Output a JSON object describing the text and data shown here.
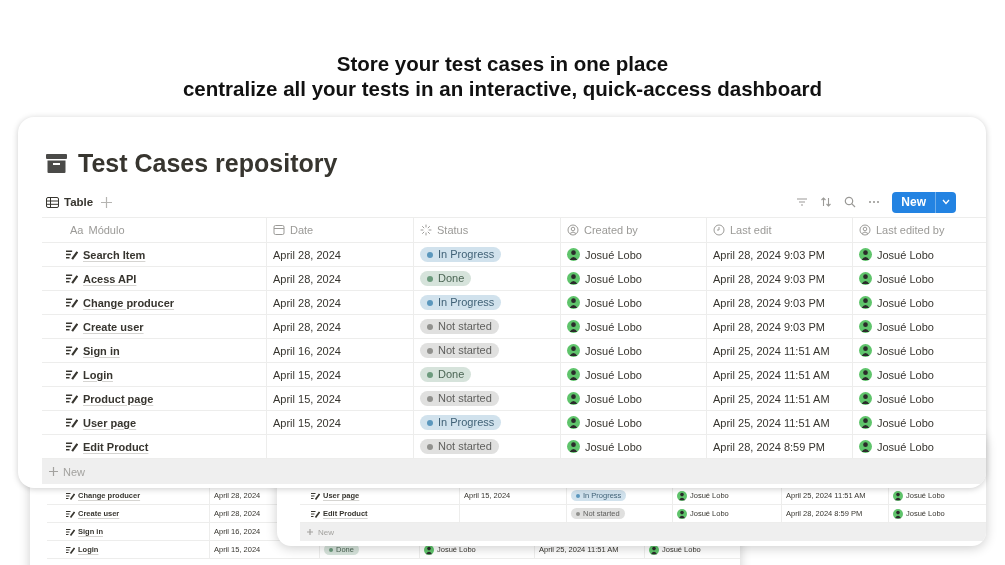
{
  "headline": [
    "Store your test cases in one place",
    "centralize all your tests in an interactive, quick-access dashboard"
  ],
  "main_window": {
    "title": "Test Cases repository",
    "view_tab": "Table",
    "new_button": "New",
    "columns": [
      {
        "kind": "title",
        "icon_text": "Aa",
        "label": "Módulo"
      },
      {
        "kind": "date",
        "label": "Date"
      },
      {
        "kind": "status",
        "label": "Status"
      },
      {
        "kind": "person",
        "label": "Created by"
      },
      {
        "kind": "clock",
        "label": "Last edit"
      },
      {
        "kind": "person",
        "label": "Last edited by"
      }
    ],
    "rows": [
      {
        "name": "Search Item",
        "date": "April 28, 2024",
        "status": "In Progress",
        "color": "#5b97bd",
        "created_by": "Josué Lobo",
        "last_edit": "April 28, 2024 9:03 PM",
        "last_edited_by": "Josué Lobo"
      },
      {
        "name": "Acess API",
        "date": "April 28, 2024",
        "status": "Done",
        "color": "#6c9b7d",
        "created_by": "Josué Lobo",
        "last_edit": "April 28, 2024 9:03 PM",
        "last_edited_by": "Josué Lobo"
      },
      {
        "name": "Change producer",
        "date": "April 28, 2024",
        "status": "In Progress",
        "color": "#5b97bd",
        "created_by": "Josué Lobo",
        "last_edit": "April 28, 2024 9:03 PM",
        "last_edited_by": "Josué Lobo"
      },
      {
        "name": "Create user",
        "date": "April 28, 2024",
        "status": "Not started",
        "color": "#91918e",
        "created_by": "Josué Lobo",
        "last_edit": "April 28, 2024 9:03 PM",
        "last_edited_by": "Josué Lobo"
      },
      {
        "name": "Sign in",
        "date": "April 16, 2024",
        "status": "Not started",
        "color": "#91918e",
        "created_by": "Josué Lobo",
        "last_edit": "April 25, 2024 11:51 AM",
        "last_edited_by": "Josué Lobo"
      },
      {
        "name": "Login",
        "date": "April 15, 2024",
        "status": "Done",
        "color": "#6c9b7d",
        "created_by": "Josué Lobo",
        "last_edit": "April 25, 2024 11:51 AM",
        "last_edited_by": "Josué Lobo"
      },
      {
        "name": "Product page",
        "date": "April 15, 2024",
        "status": "Not started",
        "color": "#91918e",
        "created_by": "Josué Lobo",
        "last_edit": "April 25, 2024 11:51 AM",
        "last_edited_by": "Josué Lobo"
      },
      {
        "name": "User page",
        "date": "April 15, 2024",
        "status": "In Progress",
        "color": "#5b97bd",
        "created_by": "Josué Lobo",
        "last_edit": "April 25, 2024 11:51 AM",
        "last_edited_by": "Josué Lobo"
      },
      {
        "name": "Edit Product",
        "status": "Not started",
        "color": "#91918e",
        "created_by": "Josué Lobo",
        "last_edit": "April 28, 2024 8:59 PM",
        "last_edited_by": "Josué Lobo"
      }
    ],
    "new_row": "New"
  },
  "back_windows": [
    {
      "rows": [
        {
          "name": "User page",
          "date": "April 15, 2024",
          "status": "In Progress",
          "color": "#5b97bd",
          "created_by": "Josué Lobo",
          "last_edit": "April 25, 2024 11:51 AM",
          "last_edited_by": "Josué Lobo"
        },
        {
          "name": "Edit Product",
          "status": "Not started",
          "color": "#91918e",
          "created_by": "Josué Lobo",
          "last_edit": "April 28, 2024 8:59 PM",
          "last_edited_by": "Josué Lobo"
        }
      ],
      "new_row": "New"
    },
    {
      "rows": [
        {
          "name": "Change producer",
          "date": "April 28, 2024"
        },
        {
          "name": "Create user",
          "date": "April 28, 2024"
        },
        {
          "name": "Sign in",
          "date": "April 16, 2024"
        },
        {
          "name": "Login",
          "date": "April 15, 2024",
          "status": "Done",
          "color": "#6c9b7d",
          "created_by": "Josué Lobo",
          "last_edit": "April 25, 2024 11:51 AM",
          "last_edited_by": "Josué Lobo"
        }
      ]
    }
  ]
}
